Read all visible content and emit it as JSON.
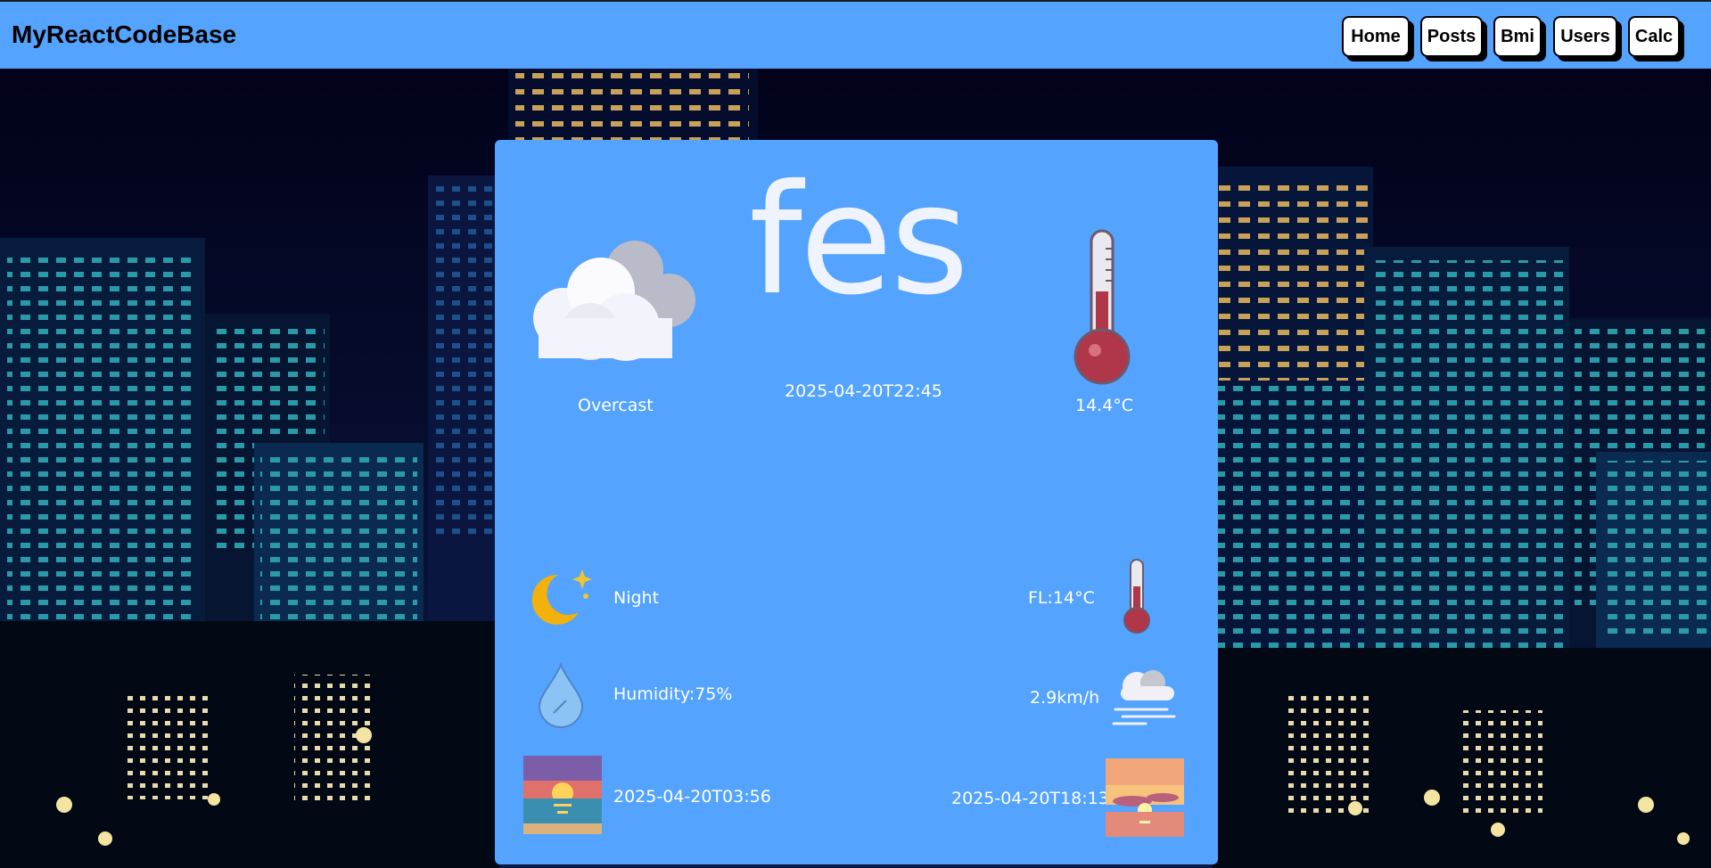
{
  "header": {
    "brand": "MyReactCodeBase",
    "nav": [
      {
        "label": "Home"
      },
      {
        "label": "Posts"
      },
      {
        "label": "Bmi"
      },
      {
        "label": "Users"
      },
      {
        "label": "Calc"
      }
    ]
  },
  "weather": {
    "city": "fes",
    "condition": "Overcast",
    "local_time": "2025-04-20T22:45",
    "temperature": "14.4°C",
    "day_period": "Night",
    "feels_like": "FL:14°C",
    "humidity": "Humidity:75%",
    "wind": "2.9km/h",
    "sunrise": "2025-04-20T03:56",
    "sunset": "2025-04-20T18:13"
  },
  "icons": {
    "condition": "cloud-icon",
    "temperature": "thermometer-icon",
    "day_period": "moon-icon",
    "feels_like": "thermometer-small-icon",
    "humidity": "water-drop-icon",
    "wind": "wind-cloud-icon",
    "sunrise": "sunrise-image",
    "sunset": "sunset-image"
  },
  "colors": {
    "header_bg": "#54a3ff",
    "card_bg": "#54a3ff",
    "background": "#03031a"
  }
}
